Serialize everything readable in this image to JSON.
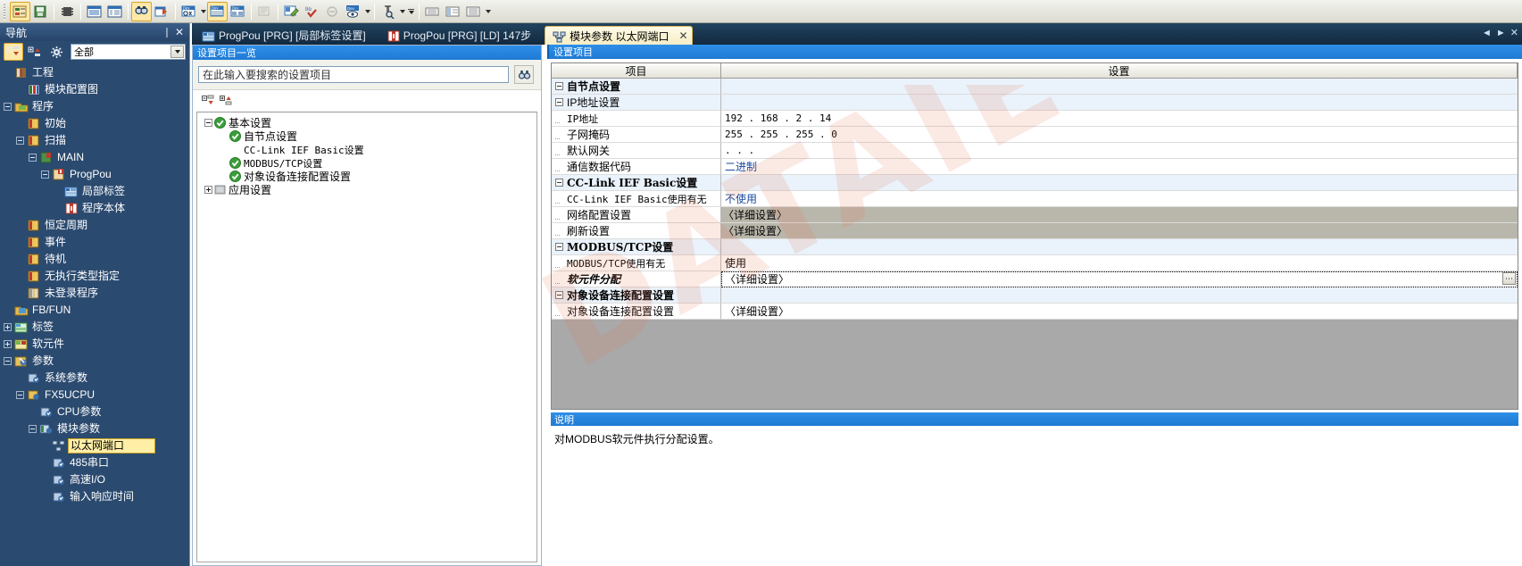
{
  "toolbar": {
    "buttons": [
      {
        "name": "project-tree-icon",
        "label": ""
      },
      {
        "name": "save-project-icon",
        "label": ""
      },
      {
        "name": "module-config-icon",
        "label": ""
      },
      {
        "name": "list-view-icon",
        "label": ""
      },
      {
        "name": "detail-view-icon",
        "label": ""
      },
      {
        "name": "find-icon",
        "label": ""
      },
      {
        "name": "find-replace-icon",
        "label": ""
      },
      {
        "name": "device-find-icon",
        "label": ""
      },
      {
        "name": "device-list-icon",
        "label": ""
      },
      {
        "name": "device-batch-icon",
        "label": ""
      },
      {
        "name": "print-preview-icon",
        "label": ""
      },
      {
        "name": "comment-edit-icon",
        "label": ""
      },
      {
        "name": "io-assignment-icon",
        "label": ""
      },
      {
        "name": "simulation-icon",
        "label": ""
      },
      {
        "name": "device-monitor-icon",
        "label": ""
      },
      {
        "name": "watch-icon",
        "label": ""
      },
      {
        "name": "ladder-narrow-icon",
        "label": ""
      },
      {
        "name": "ladder-wide-icon",
        "label": ""
      },
      {
        "name": "ladder-list-icon",
        "label": ""
      }
    ]
  },
  "nav": {
    "title": "导航",
    "pin_glyph": "丨",
    "close_glyph": "✕",
    "filter_selected": "全部",
    "tools": [
      {
        "name": "collapse-all-icon"
      },
      {
        "name": "expand-all-icon"
      },
      {
        "name": "nav-settings-icon"
      }
    ],
    "items": [
      {
        "label": "工程",
        "indent": 0,
        "expander": "none",
        "icon": "project-icon"
      },
      {
        "label": "模块配置图",
        "indent": 1,
        "expander": "none",
        "icon": "module-config-icon"
      },
      {
        "label": "程序",
        "indent": 0,
        "expander": "minus",
        "icon": "program-folder-icon"
      },
      {
        "label": "初始",
        "indent": 1,
        "expander": "none",
        "icon": "program-icon"
      },
      {
        "label": "扫描",
        "indent": 1,
        "expander": "minus",
        "icon": "program-icon"
      },
      {
        "label": "MAIN",
        "indent": 2,
        "expander": "minus",
        "icon": "main-program-icon"
      },
      {
        "label": "ProgPou",
        "indent": 3,
        "expander": "minus",
        "icon": "pou-icon"
      },
      {
        "label": "局部标签",
        "indent": 4,
        "expander": "none",
        "icon": "local-label-icon"
      },
      {
        "label": "程序本体",
        "indent": 4,
        "expander": "none",
        "icon": "program-body-icon"
      },
      {
        "label": "恒定周期",
        "indent": 1,
        "expander": "none",
        "icon": "program-icon"
      },
      {
        "label": "事件",
        "indent": 1,
        "expander": "none",
        "icon": "program-icon"
      },
      {
        "label": "待机",
        "indent": 1,
        "expander": "none",
        "icon": "program-icon"
      },
      {
        "label": "无执行类型指定",
        "indent": 1,
        "expander": "none",
        "icon": "program-icon"
      },
      {
        "label": "未登录程序",
        "indent": 1,
        "expander": "none",
        "icon": "unregistered-program-icon"
      },
      {
        "label": "FB/FUN",
        "indent": 0,
        "expander": "none",
        "icon": "fbfun-icon"
      },
      {
        "label": "标签",
        "indent": 0,
        "expander": "plus",
        "icon": "label-icon"
      },
      {
        "label": "软元件",
        "indent": 0,
        "expander": "plus",
        "icon": "device-icon"
      },
      {
        "label": "参数",
        "indent": 0,
        "expander": "minus",
        "icon": "parameter-icon"
      },
      {
        "label": "系统参数",
        "indent": 1,
        "expander": "none",
        "icon": "system-parameter-icon"
      },
      {
        "label": "FX5UCPU",
        "indent": 1,
        "expander": "minus",
        "icon": "cpu-icon"
      },
      {
        "label": "CPU参数",
        "indent": 2,
        "expander": "none",
        "icon": "cpu-parameter-icon"
      },
      {
        "label": "模块参数",
        "indent": 2,
        "expander": "minus",
        "icon": "module-parameter-icon"
      },
      {
        "label": "以太网端口",
        "indent": 3,
        "expander": "none",
        "icon": "ethernet-port-icon",
        "selected": true
      },
      {
        "label": "485串口",
        "indent": 3,
        "expander": "none",
        "icon": "serial-port-icon"
      },
      {
        "label": "高速I/O",
        "indent": 3,
        "expander": "none",
        "icon": "highspeed-io-icon"
      },
      {
        "label": "输入响应时间",
        "indent": 3,
        "expander": "none",
        "icon": "input-response-icon"
      }
    ]
  },
  "tabs": {
    "items": [
      {
        "label": "ProgPou [PRG] [局部标签设置]",
        "icon": "local-label-icon",
        "active": false
      },
      {
        "label": "ProgPou [PRG] [LD] 147步",
        "icon": "ladder-icon",
        "active": false
      },
      {
        "label": "模块参数 以太网端口",
        "icon": "ethernet-port-icon",
        "active": true,
        "close_glyph": "✕"
      }
    ],
    "nav_prev": "◄",
    "nav_next": "►",
    "nav_close": "✕"
  },
  "mid_panel": {
    "caption": "设置项目一览",
    "search_value": "",
    "search_placeholder": "在此输入要搜索的设置项目",
    "find_icon": "binoculars-icon",
    "tools": [
      {
        "name": "collapse-tree-icon"
      },
      {
        "name": "expand-tree-icon"
      }
    ],
    "tree": [
      {
        "label": "基本设置",
        "indent": 0,
        "expander": "minus",
        "check": "green-check"
      },
      {
        "label": "自节点设置",
        "indent": 1,
        "expander": "none",
        "check": "green-check"
      },
      {
        "label": "CC-Link IEF Basic设置",
        "indent": 1,
        "expander": "none",
        "check": "none",
        "mono": true
      },
      {
        "label": "MODBUS/TCP设置",
        "indent": 1,
        "expander": "none",
        "check": "green-check",
        "mono": true
      },
      {
        "label": "对象设备连接配置设置",
        "indent": 1,
        "expander": "none",
        "check": "green-check"
      },
      {
        "label": "应用设置",
        "indent": 0,
        "expander": "plus",
        "check": "gray-box"
      }
    ]
  },
  "right_panel": {
    "caption": "设置项目",
    "columns": [
      "项目",
      "设置"
    ],
    "rows": [
      {
        "label": "自节点设置",
        "value": "",
        "indent": 0,
        "expander": "minus",
        "style": "hdr",
        "shade": "blue"
      },
      {
        "label": "IP地址设置",
        "value": "",
        "indent": 1,
        "expander": "minus",
        "style": "normal",
        "shade": "blue"
      },
      {
        "label": "IP地址",
        "value": "192 . 168 .   2 .  14",
        "indent": 2,
        "expander": "leaf",
        "style": "mono",
        "value_style": "mono",
        "shade": "white"
      },
      {
        "label": "子网掩码",
        "value": "255 . 255 . 255 .   0",
        "indent": 2,
        "expander": "leaf",
        "style": "normal",
        "value_style": "mono",
        "shade": "white"
      },
      {
        "label": "默认网关",
        "value": "      .       .       .",
        "indent": 2,
        "expander": "leaf",
        "style": "normal",
        "value_style": "mono",
        "shade": "white"
      },
      {
        "label": "通信数据代码",
        "value": "二进制",
        "indent": 1,
        "expander": "leaf",
        "style": "normal",
        "value_style": "blue",
        "shade": "white"
      },
      {
        "label": "CC-Link IEF Basic设置",
        "value": "",
        "indent": 0,
        "expander": "minus",
        "style": "hdr",
        "shade": "blue"
      },
      {
        "label": "CC-Link IEF Basic使用有无",
        "value": "不使用",
        "indent": 1,
        "expander": "leaf",
        "style": "mono",
        "value_style": "blue",
        "shade": "white"
      },
      {
        "label": "网络配置设置",
        "value": "〈详细设置〉",
        "indent": 1,
        "expander": "leaf",
        "style": "normal",
        "value_style": "detail",
        "shade": "white"
      },
      {
        "label": "刷新设置",
        "value": "〈详细设置〉",
        "indent": 1,
        "expander": "leaf",
        "style": "normal",
        "value_style": "detail",
        "shade": "white"
      },
      {
        "label": "MODBUS/TCP设置",
        "value": "",
        "indent": 0,
        "expander": "minus",
        "style": "hdr",
        "shade": "blue"
      },
      {
        "label": "MODBUS/TCP使用有无",
        "value": "使用",
        "indent": 1,
        "expander": "leaf",
        "style": "mono",
        "value_style": "normal",
        "shade": "white"
      },
      {
        "label": "软元件分配",
        "value": "〈详细设置〉",
        "indent": 1,
        "expander": "leaf",
        "style": "ital",
        "value_style": "selected",
        "shade": "white",
        "selected": true
      },
      {
        "label": "对象设备连接配置设置",
        "value": "",
        "indent": 0,
        "expander": "minus",
        "style": "hdr",
        "shade": "blue"
      },
      {
        "label": "对象设备连接配置设置",
        "value": "〈详细设置〉",
        "indent": 1,
        "expander": "leaf",
        "style": "normal",
        "value_style": "normal",
        "shade": "white"
      }
    ],
    "dropdown_glyph": "⋯"
  },
  "description": {
    "caption": "说明",
    "text": "对MODBUS软元件执行分配设置。"
  },
  "watermark": "DATAIE",
  "colors": {
    "accent_blue": "#1f7ad4",
    "nav_bg": "#2b4a6f",
    "selection_yellow": "#ffeea6",
    "row_blue": "#eaf2fb",
    "detail_gray": "#b9b6ab"
  }
}
